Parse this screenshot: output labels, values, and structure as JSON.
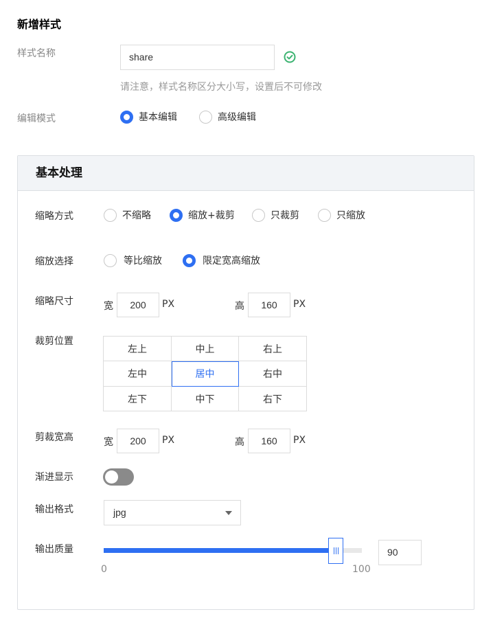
{
  "page": {
    "title": "新增样式"
  },
  "style_name": {
    "label": "样式名称",
    "value": "share",
    "hint": "请注意，样式名称区分大小写，设置后不可修改",
    "valid_icon": "check-circle-icon",
    "valid_color": "#3cb371"
  },
  "edit_mode": {
    "label": "编辑模式",
    "options": [
      {
        "label": "基本编辑",
        "checked": true
      },
      {
        "label": "高级编辑",
        "checked": false
      }
    ]
  },
  "panel": {
    "title": "基本处理",
    "thumb_mode": {
      "label": "缩略方式",
      "options": [
        {
          "label": "不缩略",
          "checked": false
        },
        {
          "label": "缩放+裁剪",
          "checked": true
        },
        {
          "label": "只裁剪",
          "checked": false
        },
        {
          "label": "只缩放",
          "checked": false
        }
      ]
    },
    "scale_choice": {
      "label": "缩放选择",
      "options": [
        {
          "label": "等比缩放",
          "checked": false
        },
        {
          "label": "限定宽高缩放",
          "checked": true
        }
      ]
    },
    "thumb_size": {
      "label": "缩略尺寸",
      "width_label": "宽",
      "width_value": "200",
      "width_unit": "PX",
      "height_label": "高",
      "height_value": "160",
      "height_unit": "PX"
    },
    "crop_position": {
      "label": "裁剪位置",
      "cells": [
        "左上",
        "中上",
        "右上",
        "左中",
        "居中",
        "右中",
        "左下",
        "中下",
        "右下"
      ],
      "selected": "居中"
    },
    "crop_size": {
      "label": "剪裁宽高",
      "width_label": "宽",
      "width_value": "200",
      "width_unit": "PX",
      "height_label": "高",
      "height_value": "160",
      "height_unit": "PX"
    },
    "progressive": {
      "label": "渐进显示",
      "enabled": false
    },
    "output_format": {
      "label": "输出格式",
      "value": "jpg"
    },
    "output_quality": {
      "label": "输出质量",
      "min": "0",
      "max": "100",
      "value": "90"
    }
  },
  "colors": {
    "accent": "#2e6ff2",
    "toggle_off": "#8a8a8a"
  }
}
